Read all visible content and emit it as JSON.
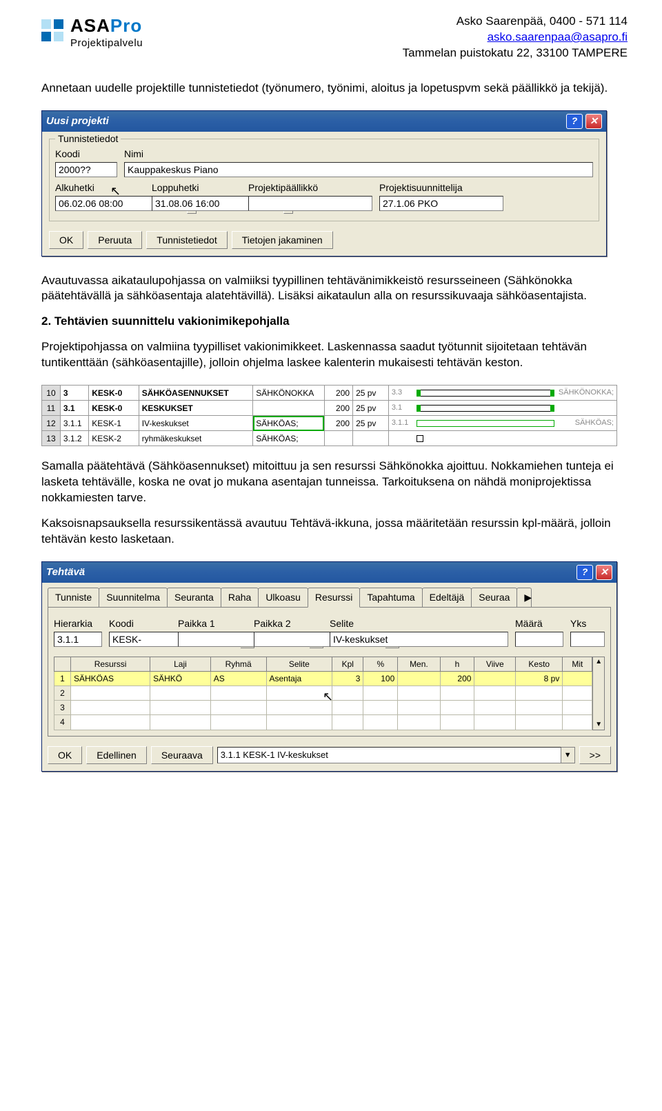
{
  "header": {
    "logo_asa": "ASA",
    "logo_pro": "Pro",
    "logo_sub": "Projektipalvelu",
    "contact_line1": "Asko Saarenpää, 0400 - 571 114",
    "email": "asko.saarenpaa@asapro.fi",
    "contact_line3": "Tammelan puistokatu 22, 33100 TAMPERE"
  },
  "text": {
    "p1": "Annetaan uudelle projektille tunnistetiedot (työnumero, työnimi, aloitus ja lopetuspvm sekä päällikkö ja tekijä).",
    "p2": "Avautuvassa aikataulupohjassa on valmiiksi tyypillinen tehtävänimikkeistö resursseineen (Sähkönokka päätehtävällä ja sähköasentaja alatehtävillä). Lisäksi aikataulun alla on resurssikuvaaja sähköasentajista.",
    "h1": "2. Tehtävien suunnittelu vakionimikepohjalla",
    "p3": "Projektipohjassa on valmiina tyypilliset vakionimikkeet. Laskennassa saadut työtunnit sijoitetaan tehtävän tuntikenttään (sähköasentajille), jolloin ohjelma laskee kalenterin mukaisesti tehtävän keston.",
    "p4": "Samalla päätehtävä (Sähköasennukset) mitoittuu ja sen resurssi Sähkönokka ajoittuu. Nokkamiehen tunteja ei lasketa tehtävälle, koska ne ovat jo mukana asentajan tunneissa. Tarkoituksena on nähdä moniprojektissa nokkamiesten tarve.",
    "p5": "Kaksoisnapsauksella resurssikentässä avautuu Tehtävä-ikkuna, jossa määritetään resurssin kpl-määrä, jolloin tehtävän kesto lasketaan."
  },
  "dialog1": {
    "title": "Uusi projekti",
    "group": "Tunnistetiedot",
    "koodi_lbl": "Koodi",
    "koodi_val": "2000??",
    "nimi_lbl": "Nimi",
    "nimi_val": "Kauppakeskus Piano",
    "alku_lbl": "Alkuhetki",
    "alku_val": "06.02.06 08:00",
    "loppu_lbl": "Loppuhetki",
    "loppu_val": "31.08.06 16:00",
    "paal_lbl": "Projektipäällikkö",
    "paal_val": "",
    "suun_lbl": "Projektisuunnittelija",
    "suun_val": "27.1.06 PKO",
    "ok": "OK",
    "peruuta": "Peruuta",
    "tun": "Tunnistetiedot",
    "tie": "Tietojen jakaminen",
    "ellipsis": "..."
  },
  "tasks": {
    "rows": [
      {
        "n": "10",
        "h": "3",
        "code": "KESK-0",
        "name": "SÄHKÖASENNUKSET",
        "res": "SÄHKÖNOKKA",
        "a": "200",
        "b": "25 pv",
        "gl": "3.3",
        "gr": "SÄHKÖNOKKA;",
        "bold": true
      },
      {
        "n": "11",
        "h": "3.1",
        "code": "KESK-0",
        "name": "KESKUKSET",
        "res": "",
        "a": "200",
        "b": "25 pv",
        "gl": "3.1",
        "gr": "",
        "bold": true
      },
      {
        "n": "12",
        "h": "3.1.1",
        "code": "KESK-1",
        "name": "IV-keskukset",
        "res": "SÄHKÖAS;",
        "a": "200",
        "b": "25 pv",
        "gl": "3.1.1",
        "gr": "SÄHKÖAS;",
        "hl": true
      },
      {
        "n": "13",
        "h": "3.1.2",
        "code": "KESK-2",
        "name": "ryhmäkeskukset",
        "res": "SÄHKÖAS;",
        "a": "",
        "b": "",
        "gl": "",
        "gr": ""
      }
    ]
  },
  "dialog2": {
    "title": "Tehtävä",
    "tabs": [
      "Tunniste",
      "Suunnitelma",
      "Seuranta",
      "Raha",
      "Ulkoasu",
      "Resurssi",
      "Tapahtuma",
      "Edeltäjä",
      "Seuraa"
    ],
    "active_tab": "Resurssi",
    "hdr": {
      "hier": "Hierarkia",
      "koodi": "Koodi",
      "p1": "Paikka 1",
      "p2": "Paikka 2",
      "sel": "Selite",
      "maara": "Määrä",
      "yks": "Yks"
    },
    "vals": {
      "hier": "3.1.1",
      "koodi": "KESK-",
      "p1": "",
      "p2": "",
      "sel": "IV-keskukset",
      "maara": "",
      "yks": ""
    },
    "cols": [
      "",
      "Resurssi",
      "Laji",
      "Ryhmä",
      "Selite",
      "Kpl",
      "%",
      "Men.",
      "h",
      "Viive",
      "Kesto",
      "Mit"
    ],
    "row1": {
      "n": "1",
      "res": "SÄHKÖAS",
      "laji": "SÄHKÖ",
      "ryh": "AS",
      "sel": "Asentaja",
      "kpl": "3",
      "pct": "100",
      "men": "",
      "h": "200",
      "viive": "",
      "kesto": "8 pv"
    },
    "rnums": [
      "2",
      "3",
      "4"
    ],
    "ok": "OK",
    "edel": "Edellinen",
    "seur": "Seuraava",
    "combo": "3.1.1 KESK-1 IV-keskukset",
    "go": ">>"
  }
}
